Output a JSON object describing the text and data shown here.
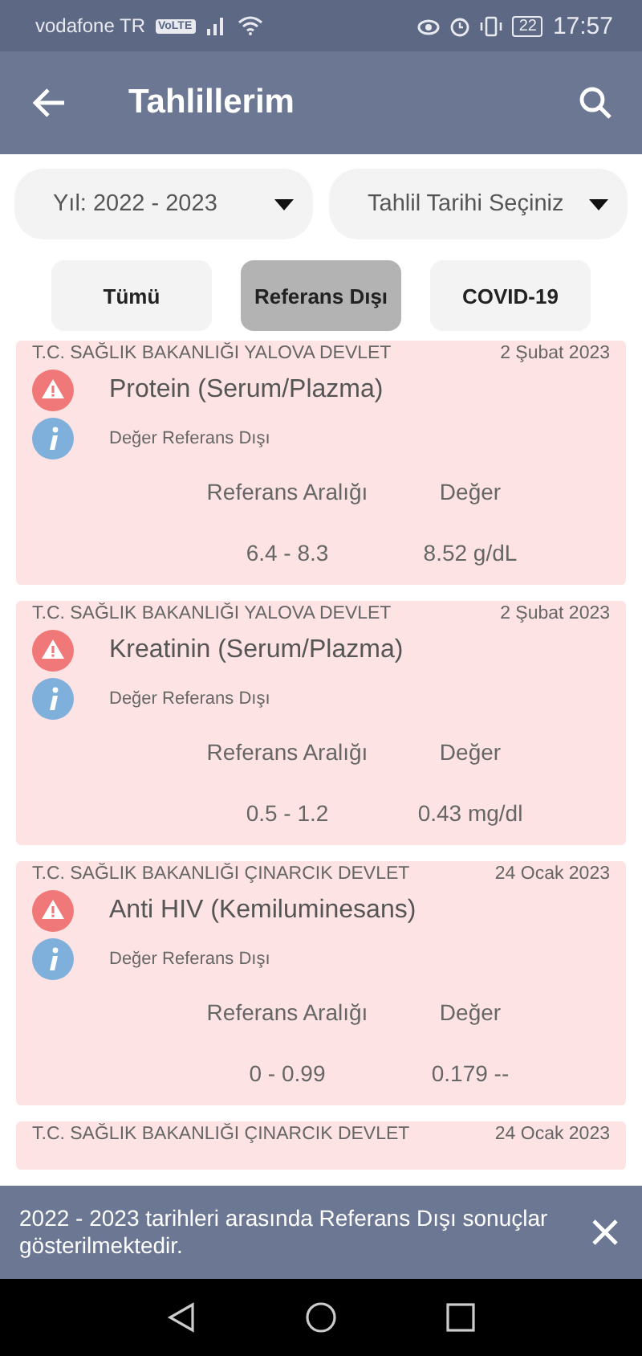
{
  "status_bar": {
    "carrier": "vodafone TR",
    "volte": "VoLTE",
    "battery": "22",
    "time": "17:57"
  },
  "app_bar": {
    "title": "Tahlillerim"
  },
  "filters": [
    {
      "label": "Yıl: 2022 - 2023"
    },
    {
      "label": "Tahlil Tarihi Seçiniz"
    }
  ],
  "tabs": [
    {
      "label": "Tümü",
      "selected": false
    },
    {
      "label": "Referans Dışı",
      "selected": true
    },
    {
      "label": "COVID-19",
      "selected": false
    }
  ],
  "results": [
    {
      "hospital": "T.C. SAĞLIK BAKANLIĞI YALOVA DEVLET",
      "date": "2 Şubat 2023",
      "test": "Protein (Serum/Plazma)",
      "status": "Değer Referans Dışı",
      "range_label": "Referans Aralığı",
      "value_label": "Değer",
      "range": "6.4 - 8.3",
      "value": "8.52 g/dL"
    },
    {
      "hospital": "T.C. SAĞLIK BAKANLIĞI YALOVA DEVLET",
      "date": "2 Şubat 2023",
      "test": "Kreatinin (Serum/Plazma)",
      "status": "Değer Referans Dışı",
      "range_label": "Referans Aralığı",
      "value_label": "Değer",
      "range": "0.5 - 1.2",
      "value": "0.43 mg/dl"
    },
    {
      "hospital": "T.C. SAĞLIK BAKANLIĞI ÇINARCIK DEVLET",
      "date": "24 Ocak 2023",
      "test": "Anti HIV (Kemiluminesans)",
      "status": "Değer Referans Dışı",
      "range_label": "Referans Aralığı",
      "value_label": "Değer",
      "range": "0 - 0.99",
      "value": "0.179 --"
    },
    {
      "hospital": "T.C. SAĞLIK BAKANLIĞI ÇINARCIK DEVLET",
      "date": "24 Ocak 2023"
    }
  ],
  "snackbar": {
    "message": "2022 - 2023 tarihleri arasında Referans Dışı sonuçlar gösterilmektedir."
  }
}
